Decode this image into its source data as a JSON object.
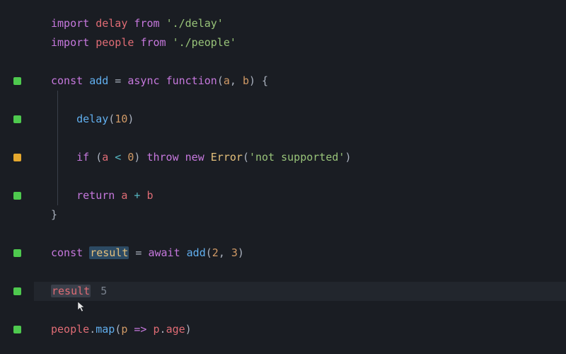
{
  "colors": {
    "bg": "#1a1d23",
    "fg": "#abb2bf",
    "keyword": "#c678dd",
    "def": "#e5c07b",
    "func": "#61afef",
    "ident": "#e06c75",
    "operator": "#56b6c2",
    "string": "#98c379",
    "number": "#d19a66",
    "marker_green": "#4ec94e",
    "marker_yellow": "#e5a82e"
  },
  "line1": {
    "import": "import",
    "delay": "delay",
    "from": "from",
    "path": "'./delay'"
  },
  "line2": {
    "import": "import",
    "people": "people",
    "from": "from",
    "path": "'./people'"
  },
  "line4": {
    "const": "const",
    "name": "add",
    "eq": " = ",
    "async": "async",
    "function": "function",
    "params_open": "(",
    "a": "a",
    "comma": ", ",
    "b": "b",
    "params_close": ") {"
  },
  "line6": {
    "call": "delay",
    "open": "(",
    "arg": "10",
    "close": ")"
  },
  "line8": {
    "if": "if",
    "open": " (",
    "a": "a",
    "op": " < ",
    "zero": "0",
    "close": ") ",
    "throw": "throw",
    "new": "new",
    "error": "Error",
    "eopen": "(",
    "msg": "'not supported'",
    "eclose": ")"
  },
  "line10": {
    "return": "return",
    "a": "a",
    "op": " + ",
    "b": "b"
  },
  "line11": {
    "brace": "}"
  },
  "line13": {
    "const": "const",
    "name": "result",
    "eq": " = ",
    "await": "await",
    "call": "add",
    "open": "(",
    "a1": "2",
    "comma": ", ",
    "a2": "3",
    "close": ")"
  },
  "line15": {
    "ident": "result",
    "value": "5"
  },
  "line17": {
    "people": "people",
    "dot": ".",
    "map": "map",
    "open": "(",
    "p": "p",
    "arrow": " => ",
    "p2": "p",
    "dot2": ".",
    "age": "age",
    "close": ")"
  }
}
